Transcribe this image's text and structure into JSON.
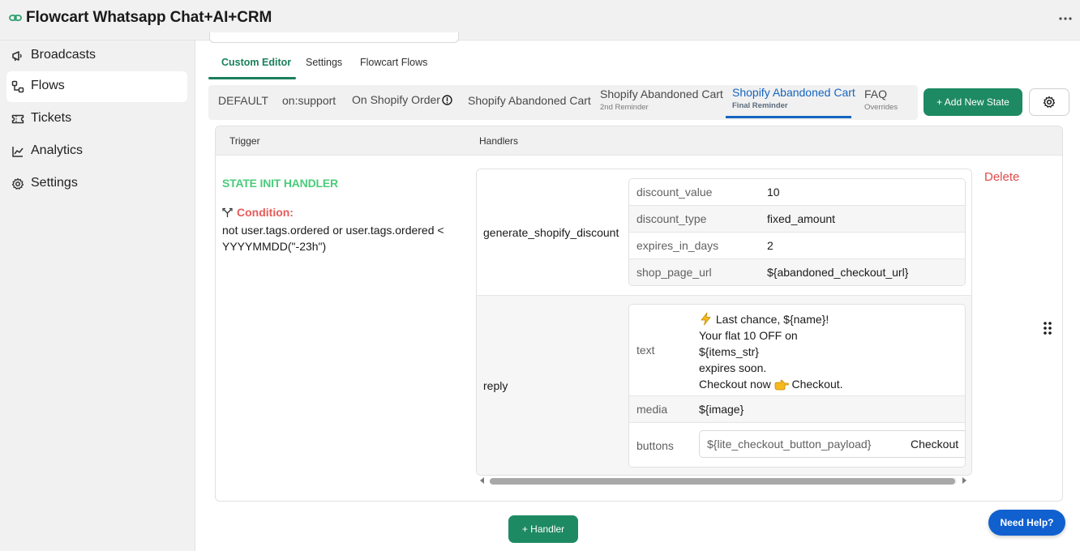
{
  "app": {
    "title": "Flowcart Whatsapp Chat+AI+CRM",
    "logo_icon": "link-icon",
    "more_icon": "more-horizontal-icon"
  },
  "sidebar": {
    "items": [
      {
        "label": "Broadcasts",
        "icon": "megaphone-icon",
        "active": false
      },
      {
        "label": "Flows",
        "icon": "flow-icon",
        "active": true
      },
      {
        "label": "Tickets",
        "icon": "ticket-icon",
        "active": false
      },
      {
        "label": "Analytics",
        "icon": "chart-icon",
        "active": false
      },
      {
        "label": "Settings",
        "icon": "gear-icon",
        "active": false
      }
    ]
  },
  "editor_tabs": [
    {
      "label": "Custom Editor",
      "active": true
    },
    {
      "label": "Settings",
      "active": false
    },
    {
      "label": "Flowcart Flows",
      "active": false
    }
  ],
  "states": [
    {
      "title": "DEFAULT",
      "subtitle": ""
    },
    {
      "title": "on:support",
      "subtitle": ""
    },
    {
      "title": "On Shopify Order",
      "subtitle": "",
      "has_info_icon": true
    },
    {
      "title": "Shopify Abandoned Cart",
      "subtitle": ""
    },
    {
      "title": "Shopify Abandoned Cart",
      "subtitle": "2nd Reminder"
    },
    {
      "title": "Shopify Abandoned Cart",
      "subtitle": "Final Reminder",
      "active": true
    },
    {
      "title": "FAQ",
      "subtitle": "Overrides"
    }
  ],
  "actions": {
    "add_state_label": "+ Add New State",
    "settings_icon": "gear-icon",
    "add_handler_label": "+ Handler",
    "help_label": "Need Help?"
  },
  "table": {
    "headers": {
      "trigger": "Trigger",
      "handlers": "Handlers"
    },
    "trigger": {
      "title": "STATE INIT HANDLER",
      "condition_label": "Condition:",
      "condition_icon": "branch-icon",
      "condition_text": "not user.tags.ordered or user.tags.ordered < YYYYMMDD(\"-23h\")"
    },
    "handlers": [
      {
        "name": "generate_shopify_discount",
        "params": [
          {
            "key": "discount_value",
            "value": "10"
          },
          {
            "key": "discount_type",
            "value": "fixed_amount"
          },
          {
            "key": "expires_in_days",
            "value": "2"
          },
          {
            "key": "shop_page_url",
            "value": "${abandoned_checkout_url}"
          }
        ]
      },
      {
        "name": "reply",
        "text_key": "text",
        "text_lines": [
          "Last chance, ${name}!",
          "Your flat 10 OFF on",
          "${items_str}",
          "expires soon.",
          "Checkout now",
          "Checkout."
        ],
        "media_key": "media",
        "media_value": "${image}",
        "buttons_key": "buttons",
        "button_payload": "${lite_checkout_button_payload}",
        "button_title": "Checkout"
      }
    ],
    "delete_label": "Delete",
    "drag_icon": "drag-handle-icon"
  }
}
